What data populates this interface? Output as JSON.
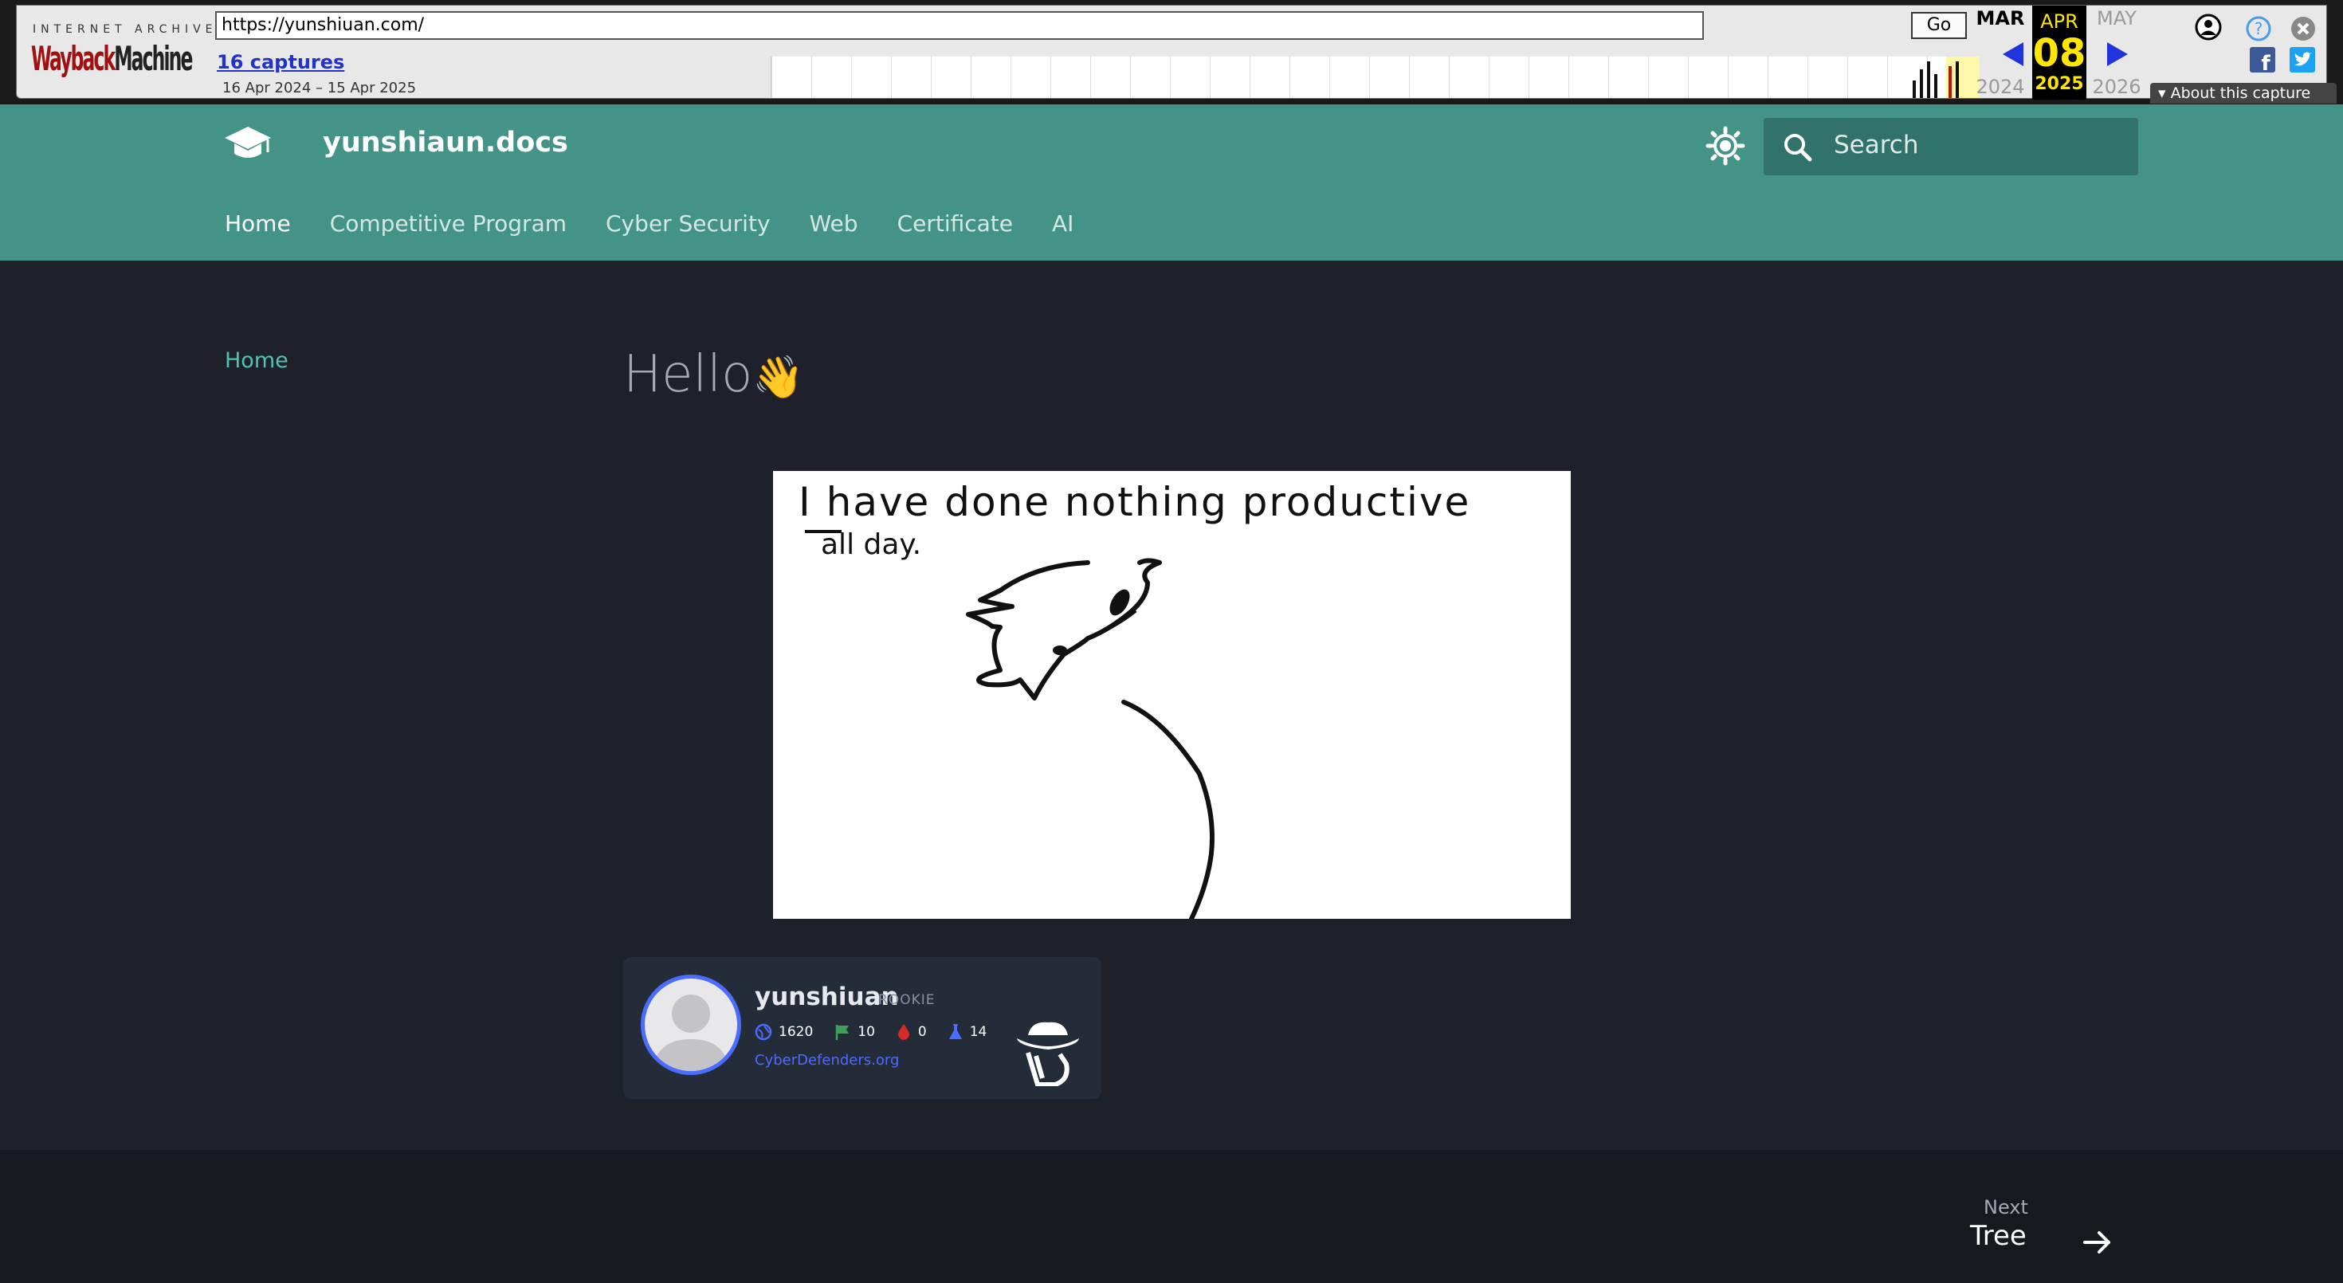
{
  "wayback": {
    "logo_top": "INTERNET ARCHIVE",
    "logo_main_1": "Wayback",
    "logo_main_2": "Machine",
    "url": "https://yunshiuan.com/",
    "go_label": "Go",
    "captures_label": "16 captures",
    "date_range": "16 Apr 2024 – 15 Apr 2025",
    "prev_month": "MAR",
    "cur_month": "APR",
    "next_month": "MAY",
    "cur_day": "08",
    "prev_year": "2024",
    "cur_year": "2025",
    "next_year": "2026",
    "about_label": "About this capture"
  },
  "header": {
    "site_title": "yunshiaun.docs",
    "search_placeholder": "Search",
    "tabs": [
      {
        "label": "Home"
      },
      {
        "label": "Competitive Program"
      },
      {
        "label": "Cyber Security"
      },
      {
        "label": "Web"
      },
      {
        "label": "Certificate"
      },
      {
        "label": "AI"
      }
    ]
  },
  "sidebar": {
    "items": [
      {
        "label": "Home"
      }
    ]
  },
  "main": {
    "title": "Hello",
    "title_emoji": "👋",
    "drawing_line1": "I have done nothing productive",
    "drawing_line2": "all day."
  },
  "badge": {
    "username": "yunshiuan",
    "rank": "ROOKIE",
    "points": "1620",
    "flags": "10",
    "bloods": "0",
    "labs": "14",
    "org": "CyberDefenders.org"
  },
  "footer": {
    "next_label": "Next",
    "next_title": "Tree"
  },
  "colors": {
    "header_bg": "#439386",
    "page_bg": "#1e2129",
    "footer_bg": "#17191f",
    "accent": "#4fc3b0"
  }
}
